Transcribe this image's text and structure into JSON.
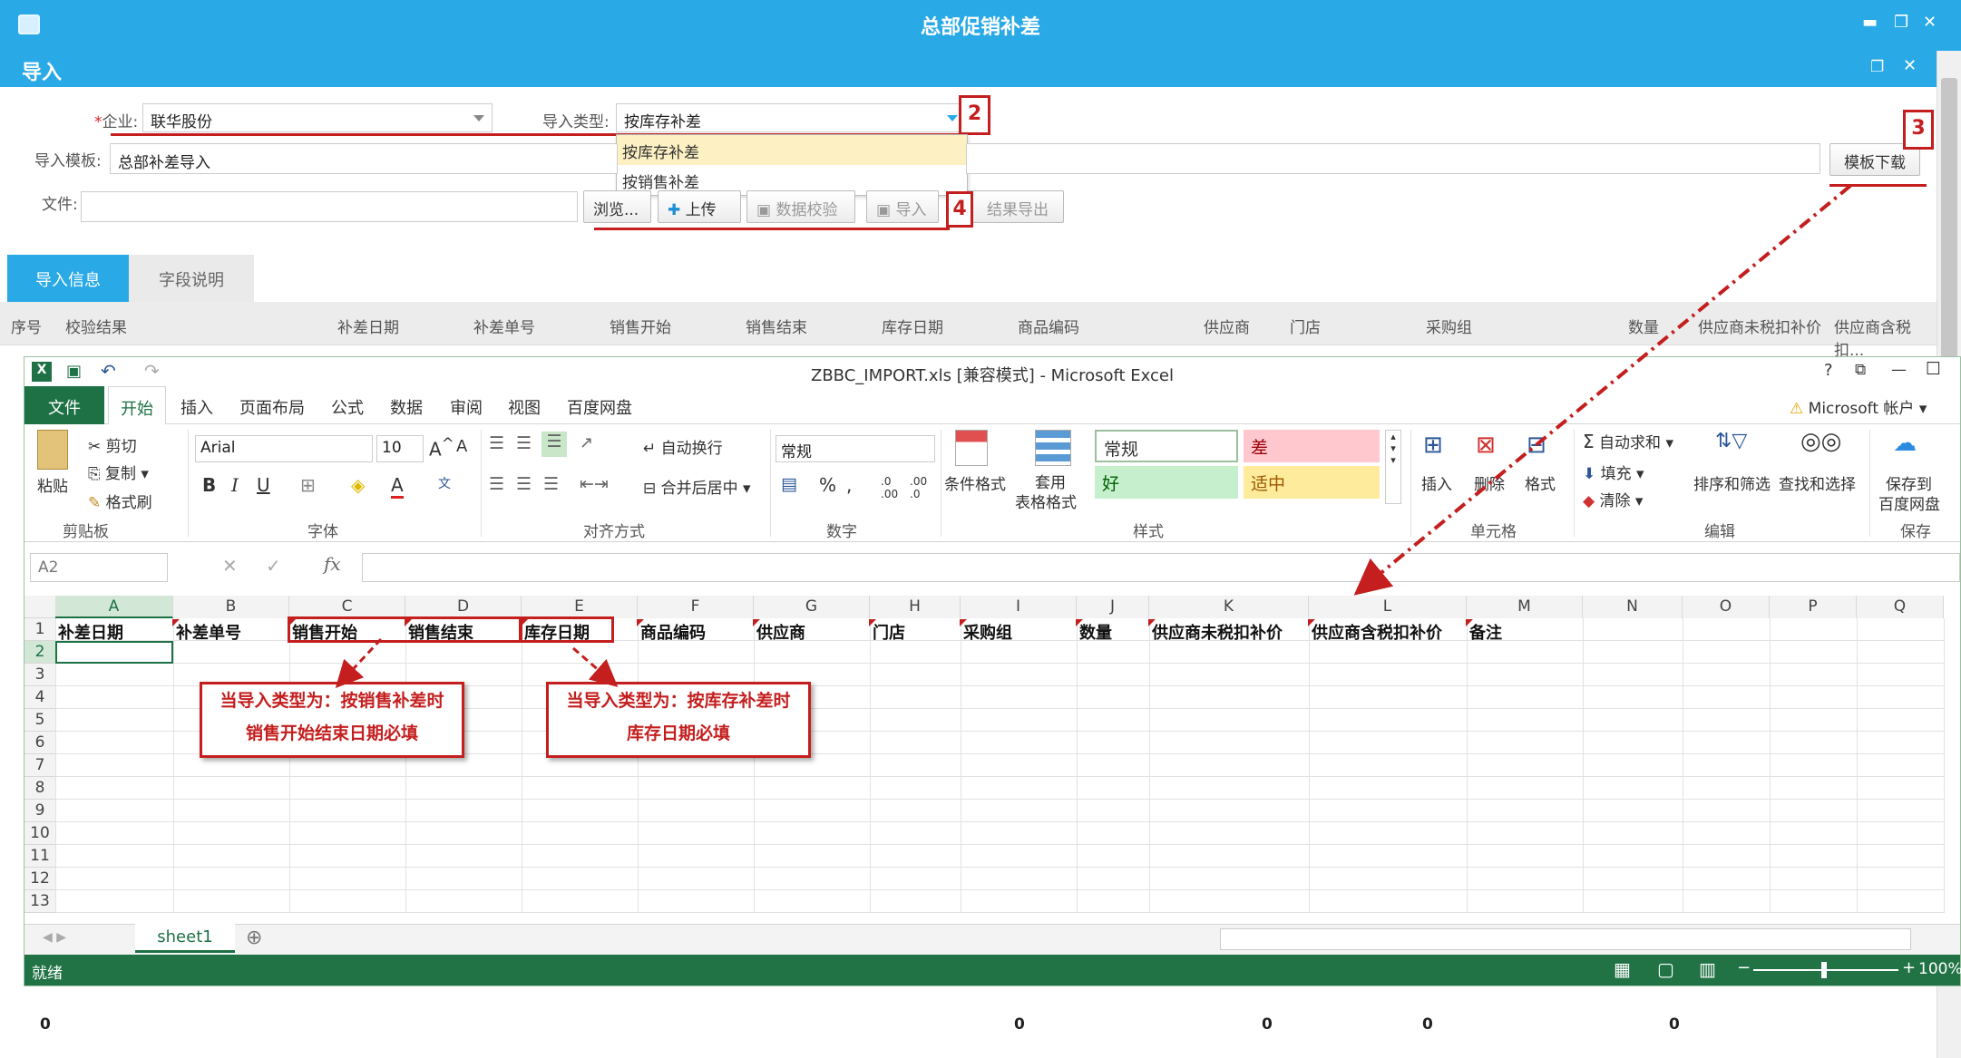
{
  "app": {
    "title": "总部促销补差"
  },
  "dialog": {
    "title": "导入"
  },
  "form": {
    "company_label": "企业:",
    "company_required": "*",
    "company_value": "联华股份",
    "import_type_label": "导入类型:",
    "import_type_value": "按库存补差",
    "import_type_options": [
      "按库存补差",
      "按销售补差"
    ],
    "template_label": "导入模板:",
    "template_value": "总部补差导入",
    "file_label": "文件:",
    "template_download": "模板下载",
    "buttons": {
      "browse": "浏览...",
      "upload": "上传",
      "validate": "数据校验",
      "import": "导入",
      "export": "结果导出"
    }
  },
  "callouts": {
    "c2": "2",
    "c3": "3",
    "c4": "4"
  },
  "tabs": [
    {
      "label": "导入信息"
    },
    {
      "label": "字段说明"
    }
  ],
  "grid_headers": [
    "序号",
    "校验结果",
    "补差日期",
    "补差单号",
    "销售开始",
    "销售结束",
    "库存日期",
    "商品编码",
    "供应商",
    "门店",
    "采购组",
    "数量",
    "供应商未税扣补价",
    "供应商含税扣..."
  ],
  "excel": {
    "window_title": "ZBBC_IMPORT.xls  [兼容模式] - Microsoft Excel",
    "menu": [
      "文件",
      "开始",
      "插入",
      "页面布局",
      "公式",
      "数据",
      "审阅",
      "视图",
      "百度网盘"
    ],
    "account": "Microsoft 帐户",
    "clipboard": {
      "paste": "粘贴",
      "cut": "剪切",
      "copy": "复制",
      "format_painter": "格式刷",
      "group": "剪贴板"
    },
    "font": {
      "name": "Arial",
      "size": "10",
      "group": "字体"
    },
    "alignment": {
      "wrap": "自动换行",
      "merge": "合并后居中",
      "group": "对齐方式"
    },
    "number": {
      "format": "常规",
      "group": "数字"
    },
    "styles": {
      "normal": "常规",
      "bad": "差",
      "good": "好",
      "neutral": "适中",
      "cond": "条件格式",
      "table1": "套用",
      "table2": "表格格式",
      "group": "样式"
    },
    "cells": {
      "insert": "插入",
      "delete": "删除",
      "format": "格式",
      "group": "单元格"
    },
    "editing": {
      "autosum": "自动求和",
      "fill": "填充",
      "clear": "清除",
      "sort": "排序和筛选",
      "find": "查找和选择",
      "group": "编辑"
    },
    "save": {
      "label1": "保存到",
      "label2": "百度网盘",
      "group": "保存"
    },
    "name_box": "A2",
    "columns": [
      "A",
      "B",
      "C",
      "D",
      "E",
      "F",
      "G",
      "H",
      "I",
      "J",
      "K",
      "L",
      "M",
      "N",
      "O",
      "P",
      "Q"
    ],
    "row1": [
      "补差日期",
      "补差单号",
      "销售开始",
      "销售结束",
      "库存日期",
      "商品编码",
      "供应商",
      "门店",
      "采购组",
      "数量",
      "供应商未税扣补价",
      "供应商含税扣补价",
      "备注"
    ],
    "rows": [
      "1",
      "2",
      "3",
      "4",
      "5",
      "6",
      "7",
      "8",
      "9",
      "10",
      "11",
      "12",
      "13"
    ],
    "sheet_tab": "sheet1",
    "status": "就绪",
    "zoom": "100%"
  },
  "notes": {
    "sales": [
      "当导入类型为：按销售补差时",
      "销售开始结束日期必填"
    ],
    "stock": [
      "当导入类型为：按库存补差时",
      "库存日期必填"
    ]
  },
  "totals": [
    "0",
    "0",
    "0",
    "0",
    "0"
  ]
}
